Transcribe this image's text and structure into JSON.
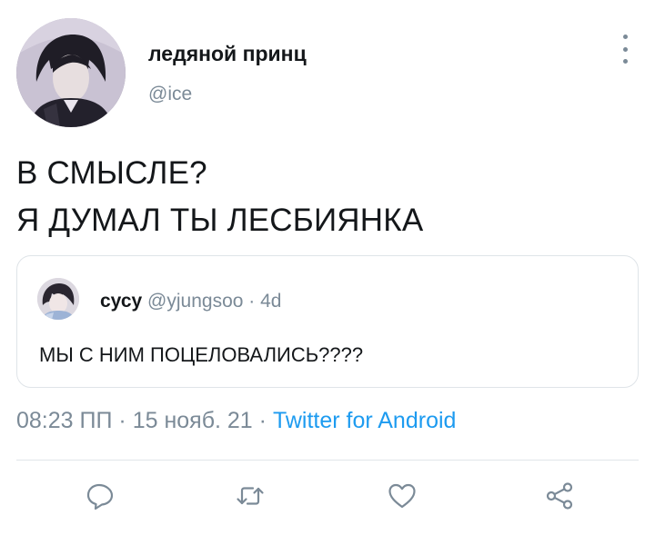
{
  "author": {
    "display_name": "ледяной принц",
    "handle": "@ice"
  },
  "tweet": {
    "lines": [
      "В СМЫСЛЕ?",
      "Я ДУМАЛ ТЫ ЛЕСБИЯНКА"
    ]
  },
  "quoted_tweet": {
    "display_name": "сусу",
    "handle": "@yjungsoo",
    "separator": "·",
    "time": "4d",
    "text": "МЫ С НИМ ПОЦЕЛОВАЛИСЬ????"
  },
  "metadata": {
    "time": "08:23 ПП",
    "separator": "·",
    "date": "15 нояб. 21",
    "source": "Twitter for Android"
  },
  "actions": [
    "reply-icon",
    "retweet-icon",
    "like-icon",
    "share-icon"
  ],
  "colors": {
    "text": "#14171a",
    "secondary": "#7b8a97",
    "link": "#1d9bf0",
    "border": "#dfe4e8"
  }
}
